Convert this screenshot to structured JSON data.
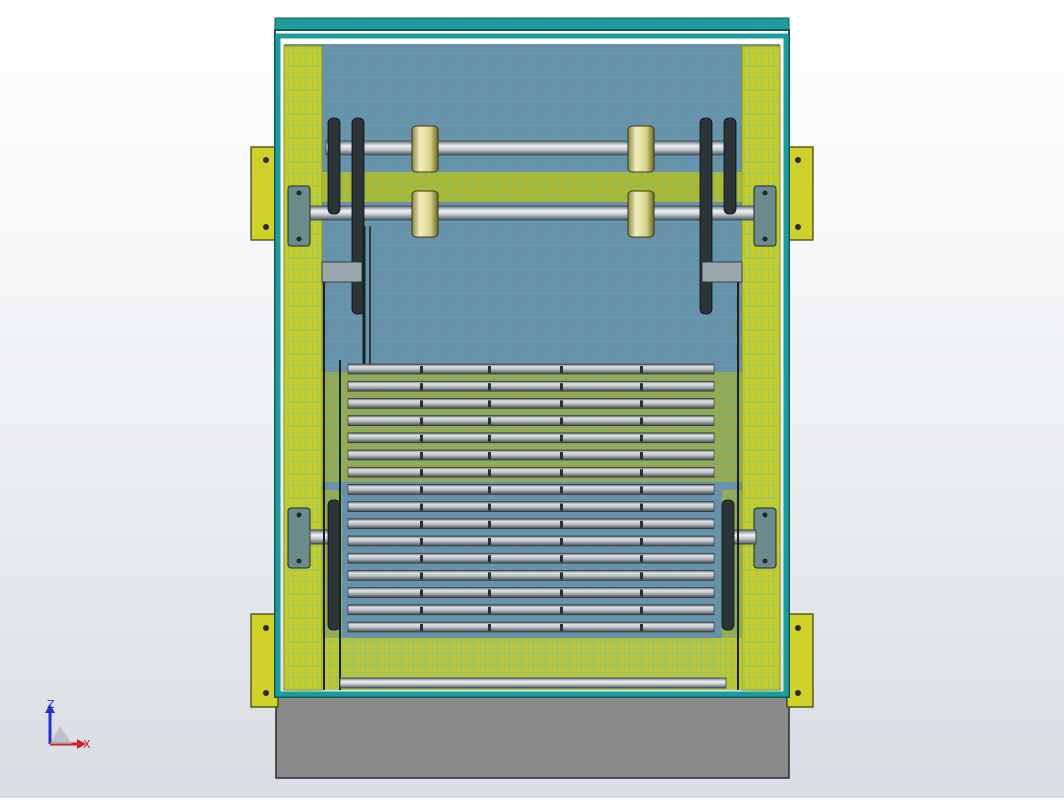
{
  "view": {
    "model": "cad-assembly-front-view",
    "colors": {
      "frame": "#1e9c9c",
      "frame_dark": "#0e5b5b",
      "panel": "#c8cc2a",
      "panel_dark": "#8c8f10",
      "mesh": "#2fc4cf",
      "shaft": "#c4ccd2",
      "shaft_dark": "#5d666c",
      "roller": "#d6d28a",
      "sprocket": "#2b3437",
      "base": "#8a8a8a",
      "bracket": "#cfd12a",
      "slat_light": "#d9dde0",
      "slat_dark": "#5b6166"
    }
  },
  "triad": {
    "z_label": "Z",
    "x_label": "X",
    "z_color": "#2233cc",
    "x_color": "#cc2222"
  }
}
